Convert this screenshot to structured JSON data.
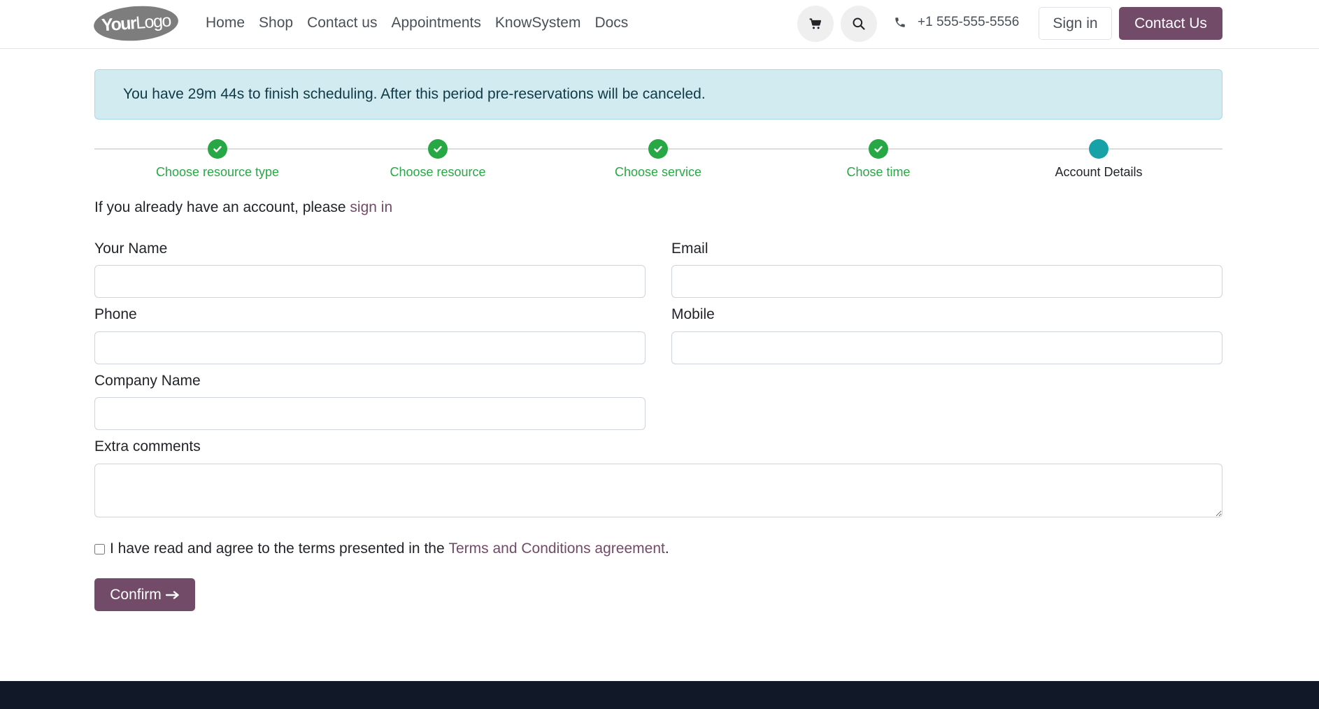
{
  "header": {
    "logo": {
      "part1": "Your",
      "part2": "Logo"
    },
    "nav": [
      "Home",
      "Shop",
      "Contact us",
      "Appointments",
      "KnowSystem",
      "Docs"
    ],
    "phone": "+1 555-555-5556",
    "signin_label": "Sign in",
    "contact_label": "Contact Us",
    "icons": {
      "cart": "cart-icon",
      "search": "search-icon",
      "phone": "phone-icon"
    }
  },
  "alert": {
    "text": "You have 29m 44s to finish scheduling. After this period pre-reservations will be canceled."
  },
  "steps": [
    {
      "label": "Choose resource type",
      "state": "done"
    },
    {
      "label": "Choose resource",
      "state": "done"
    },
    {
      "label": "Choose service",
      "state": "done"
    },
    {
      "label": "Chose time",
      "state": "done"
    },
    {
      "label": "Account Details",
      "state": "current"
    }
  ],
  "account": {
    "prefix": "If you already have an account, please ",
    "link": "sign in"
  },
  "form": {
    "name_label": "Your Name",
    "email_label": "Email",
    "phone_label": "Phone",
    "mobile_label": "Mobile",
    "company_label": "Company Name",
    "comments_label": "Extra comments",
    "name_value": "",
    "email_value": "",
    "phone_value": "",
    "mobile_value": "",
    "company_value": "",
    "comments_value": ""
  },
  "terms": {
    "prefix": "I have read and agree to the terms presented in the ",
    "link": "Terms and Conditions agreement",
    "suffix": "."
  },
  "confirm_label": "Confirm",
  "colors": {
    "brand": "#714b67",
    "success": "#28a745",
    "current_step": "#17a2a8",
    "alert_bg": "#d2ebf1",
    "footer": "#111827"
  }
}
